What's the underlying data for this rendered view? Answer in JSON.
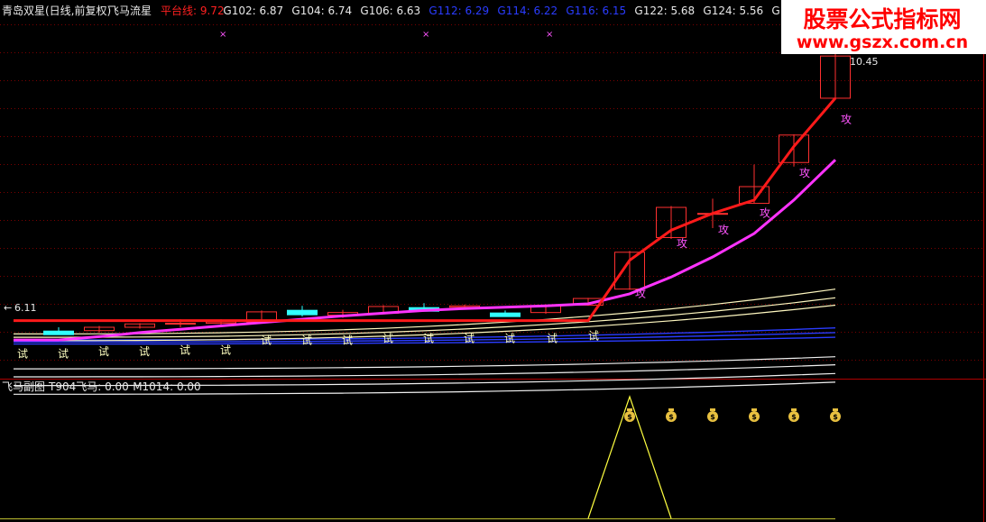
{
  "main_panel": {
    "title_left": "青岛双星(日线,前复权)",
    "title_formula": "飞马流星",
    "indicators": [
      {
        "label": "平台线: 9.72",
        "color": "#ff2020"
      },
      {
        "label": "G102: 6.87",
        "color": "#e8e8e8"
      },
      {
        "label": "G104: 6.74",
        "color": "#e8e8e8"
      },
      {
        "label": "G106: 6.63",
        "color": "#e8e8e8"
      },
      {
        "label": "G112: 6.29",
        "color": "#2a3cff"
      },
      {
        "label": "G114: 6.22",
        "color": "#2a3cff"
      },
      {
        "label": "G116: 6.15",
        "color": "#2a3cff"
      },
      {
        "label": "G122: 5.68",
        "color": "#e8e8e8"
      },
      {
        "label": "G124: 5.56",
        "color": "#e8e8e8"
      },
      {
        "label": "G126: 5.43",
        "color": "#e8e8e8"
      },
      {
        "label": "G12",
        "color": "#e8e8e8"
      }
    ]
  },
  "sub_panel": {
    "title": "飞马副图",
    "indicators": [
      {
        "label": "T904飞马: 0.00",
        "color": "#e8e8e8"
      },
      {
        "label": "M1014: 0.00",
        "color": "#e8e8e8"
      }
    ]
  },
  "watermark": {
    "line1": "股票公式指标网",
    "line2": "www.gszx.com.cn"
  },
  "colors": {
    "background": "#000000",
    "grid": "#7a0000",
    "candle": "#ff3030",
    "platform_line": "#ff1a1a",
    "magenta_line": "#ff33ff",
    "pale_line": "#fff8c0",
    "blue_line": "#2a3cff",
    "white_line": "#f0f0f0",
    "test_label": "#ffffc0",
    "attack_label": "#ff55ff",
    "triangle": "#ffff40",
    "moneybag": "#e8c040"
  },
  "chart_data": {
    "type": "candlestick",
    "ylabels": {
      "low_marker": "6.11",
      "high_marker": "10.45"
    },
    "candles": [
      {
        "o": 6.25,
        "c": 6.25,
        "h": 6.3,
        "l": 6.2,
        "color": "#30ffff"
      },
      {
        "o": 6.25,
        "c": 6.3,
        "h": 6.32,
        "l": 6.22
      },
      {
        "o": 6.3,
        "c": 6.35,
        "h": 6.36,
        "l": 6.28
      },
      {
        "o": 6.35,
        "c": 6.36,
        "h": 6.42,
        "l": 6.3
      },
      {
        "o": 6.36,
        "c": 6.38,
        "h": 6.42,
        "l": 6.33
      },
      {
        "o": 6.38,
        "c": 6.53,
        "h": 6.55,
        "l": 6.37
      },
      {
        "o": 6.56,
        "c": 6.48,
        "h": 6.62,
        "l": 6.46,
        "color": "#30ffff"
      },
      {
        "o": 6.48,
        "c": 6.52,
        "h": 6.56,
        "l": 6.44
      },
      {
        "o": 6.51,
        "c": 6.61,
        "h": 6.63,
        "l": 6.5
      },
      {
        "o": 6.6,
        "c": 6.6,
        "h": 6.66,
        "l": 6.55,
        "color": "#30ffff"
      },
      {
        "o": 6.6,
        "c": 6.62,
        "h": 6.64,
        "l": 6.57
      },
      {
        "o": 6.52,
        "c": 6.52,
        "h": 6.55,
        "l": 6.48,
        "color": "#30ffff"
      },
      {
        "o": 6.52,
        "c": 6.62,
        "h": 6.64,
        "l": 6.5
      },
      {
        "o": 6.63,
        "c": 6.73,
        "h": 6.74,
        "l": 6.62
      },
      {
        "o": 6.87,
        "c": 7.42,
        "h": 7.44,
        "l": 6.86
      },
      {
        "o": 7.64,
        "c": 8.09,
        "h": 8.11,
        "l": 7.62
      },
      {
        "o": 8.0,
        "c": 8.0,
        "h": 8.22,
        "l": 7.78
      },
      {
        "o": 8.15,
        "c": 8.4,
        "h": 8.73,
        "l": 8.15
      },
      {
        "o": 8.76,
        "c": 9.17,
        "h": 9.18,
        "l": 8.7
      },
      {
        "o": 9.72,
        "c": 10.35,
        "h": 10.45,
        "l": 9.7
      }
    ],
    "ylim": [
      5.6,
      10.85
    ],
    "x_slots": [
      65,
      110,
      155,
      200,
      245,
      290,
      335,
      380,
      425,
      470,
      515,
      560,
      605,
      652,
      698,
      744,
      790,
      836,
      880,
      926
    ],
    "platform_line": {
      "values": [
        6.4,
        6.4,
        6.4,
        6.4,
        6.4,
        6.4,
        6.4,
        6.4,
        6.4,
        6.4,
        6.4,
        6.4,
        6.4,
        6.4,
        7.3,
        7.75,
        8.0,
        8.2,
        9.0,
        9.72
      ]
    },
    "magenta_line": {
      "values": [
        6.11,
        6.16,
        6.22,
        6.27,
        6.32,
        6.37,
        6.42,
        6.47,
        6.51,
        6.55,
        6.58,
        6.6,
        6.62,
        6.65,
        6.8,
        7.05,
        7.35,
        7.7,
        8.2,
        8.8
      ]
    },
    "pale_lines": [
      {
        "start": 6.2,
        "end": 6.87
      },
      {
        "start": 6.15,
        "end": 6.74
      },
      {
        "start": 6.1,
        "end": 6.63
      }
    ],
    "blue_lines": [
      {
        "start": 6.11,
        "end": 6.29
      },
      {
        "start": 6.08,
        "end": 6.22
      },
      {
        "start": 6.05,
        "end": 6.15
      }
    ],
    "white_lines": [
      {
        "start": 5.68,
        "end": 5.86
      },
      {
        "start": 5.56,
        "end": 5.74
      },
      {
        "start": 5.43,
        "end": 5.61
      },
      {
        "start": 5.3,
        "end": 5.48
      }
    ],
    "test_markers": [
      {
        "i": 0,
        "y": 5.85,
        "text": "试"
      },
      {
        "i": 1,
        "y": 5.85,
        "text": "试"
      },
      {
        "i": 2,
        "y": 5.88,
        "text": "试"
      },
      {
        "i": 3,
        "y": 5.88,
        "text": "试"
      },
      {
        "i": 4,
        "y": 5.9,
        "text": "试"
      },
      {
        "i": 5,
        "y": 5.9,
        "text": "试"
      },
      {
        "i": 6,
        "y": 6.05,
        "text": "试"
      },
      {
        "i": 7,
        "y": 6.05,
        "text": "试"
      },
      {
        "i": 8,
        "y": 6.05,
        "text": "试"
      },
      {
        "i": 9,
        "y": 6.08,
        "text": "试"
      },
      {
        "i": 10,
        "y": 6.08,
        "text": "试"
      },
      {
        "i": 11,
        "y": 6.08,
        "text": "试"
      },
      {
        "i": 12,
        "y": 6.08,
        "text": "试"
      },
      {
        "i": 13,
        "y": 6.08,
        "text": "试"
      },
      {
        "i": 14,
        "y": 6.12,
        "text": "试"
      }
    ],
    "attack_markers": [
      {
        "i": 14,
        "y": 6.75,
        "text": "攻"
      },
      {
        "i": 15,
        "y": 7.5,
        "text": "攻"
      },
      {
        "i": 16,
        "y": 7.7,
        "text": "攻"
      },
      {
        "i": 17,
        "y": 7.95,
        "text": "攻"
      },
      {
        "i": 18,
        "y": 8.55,
        "text": "攻"
      },
      {
        "i": 19,
        "y": 9.35,
        "text": "攻"
      }
    ],
    "top_markers": [
      {
        "i": 5,
        "text": "×"
      },
      {
        "i": 10,
        "text": "×"
      },
      {
        "i": 13,
        "text": "×"
      }
    ],
    "sub_chart": {
      "type": "line",
      "ylim": [
        0,
        1
      ],
      "line": [
        {
          "i": 13,
          "v": 0
        },
        {
          "i": 14,
          "v": 1
        },
        {
          "i": 15,
          "v": 0
        }
      ],
      "moneybags": [
        14,
        15,
        16,
        17,
        18,
        19
      ]
    }
  }
}
